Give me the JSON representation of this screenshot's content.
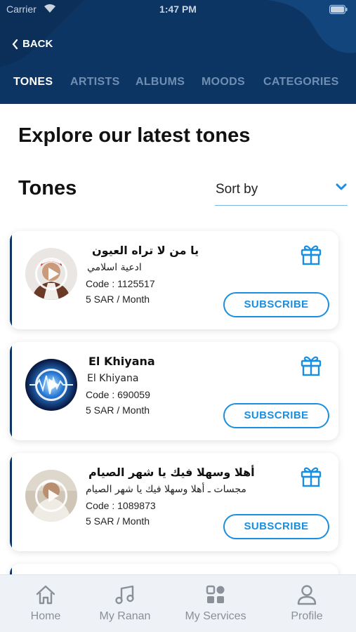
{
  "status_bar": {
    "carrier": "Carrier",
    "time": "1:47 PM"
  },
  "header": {
    "back_label": "BACK",
    "tabs": [
      {
        "label": "TONES",
        "active": true
      },
      {
        "label": "ARTISTS",
        "active": false
      },
      {
        "label": "ALBUMS",
        "active": false
      },
      {
        "label": "MOODS",
        "active": false
      },
      {
        "label": "CATEGORIES",
        "active": false
      }
    ]
  },
  "main": {
    "page_title": "Explore our latest tones",
    "section_title": "Tones",
    "sort_label": "Sort by"
  },
  "tones": [
    {
      "title": "يا من لا تراه العيون",
      "artist": "ادعية اسلامي",
      "code": "Code : 1125517",
      "price": "5 SAR / Month",
      "subscribe_label": "SUBSCRIBE"
    },
    {
      "title": "El Khiyana",
      "artist": "El Khiyana",
      "code": "Code : 690059",
      "price": "5 SAR / Month",
      "subscribe_label": "SUBSCRIBE"
    },
    {
      "title": "أهلا وسهلا فيك يا شهر الصيام",
      "artist": "مجسات ـ أهلا وسهلا فيك يا شهر الصيام",
      "code": "Code : 1089873",
      "price": "5 SAR / Month",
      "subscribe_label": "SUBSCRIBE"
    }
  ],
  "bottom_nav": {
    "items": [
      {
        "label": "Home",
        "icon": "home-icon"
      },
      {
        "label": "My Ranan",
        "icon": "music-note-icon"
      },
      {
        "label": "My Services",
        "icon": "grid-icon"
      },
      {
        "label": "Profile",
        "icon": "user-icon"
      }
    ]
  },
  "colors": {
    "header_bg": "#0d3563",
    "accent": "#1a8ee0",
    "tab_active": "#ffffff",
    "tab_inactive": "#6f8fb2",
    "nav_bg": "#eef1f6"
  }
}
